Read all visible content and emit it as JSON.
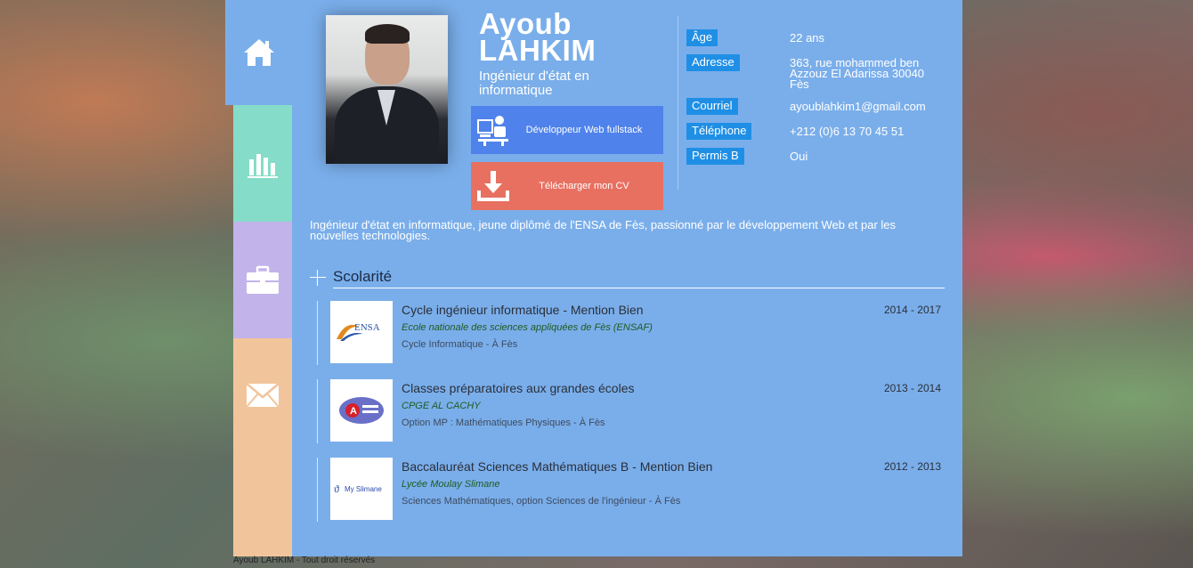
{
  "profile": {
    "first_name": "Ayoub",
    "last_name": "LAHKIM",
    "title": "Ingénieur d'état en informatique",
    "bio": "Ingénieur d'état en informatique, jeune diplômé de l'ENSA de Fès, passionné par le développement Web et par les nouvelles technologies."
  },
  "buttons": {
    "dev": "Développeur Web fullstack",
    "cv": "Télécharger mon CV"
  },
  "info": [
    {
      "label": "Âge",
      "value": "22 ans"
    },
    {
      "label": "Adresse",
      "value": "363, rue mohammed ben Azzouz El Adarissa 30040 Fès"
    },
    {
      "label": "Courriel",
      "value": "ayoublahkim1@gmail.com"
    },
    {
      "label": "Téléphone",
      "value": "+212 (0)6 13 70 45 51"
    },
    {
      "label": "Permis B",
      "value": "Oui"
    }
  ],
  "schooling": {
    "heading": "Scolarité",
    "items": [
      {
        "logo_text": "ENSA",
        "title": "Cycle ingénieur informatique - Mention Bien",
        "school": "Ecole nationale des sciences appliquées de Fès (ENSAF)",
        "detail": "Cycle Informatique - À Fès",
        "years": "2014 - 2017"
      },
      {
        "logo_text": "A",
        "title": "Classes préparatoires aux grandes écoles",
        "school": "CPGE AL CACHY",
        "detail": "Option MP : Mathématiques Physiques - À Fès",
        "years": "2013 - 2014"
      },
      {
        "logo_text": "My Slimane",
        "title": "Baccalauréat Sciences Mathématiques B - Mention Bien",
        "school": "Lycée Moulay Slimane",
        "detail": "Sciences Mathématiques, option Sciences de l'ingénieur - À Fès",
        "years": "2012 - 2013"
      }
    ]
  },
  "footer": "Ayoub LAHKIM - Tout droit réservés",
  "colors": {
    "panel": "#7aaeea",
    "tab_stats": "#85dcc8",
    "tab_work": "#c2b3ea",
    "tab_mail": "#f2c49b",
    "btn_dev": "#4f82ea",
    "btn_cv": "#e87061",
    "label_bg": "#1f8fe6"
  },
  "icons": {
    "nav": [
      "home-icon",
      "bar-chart-icon",
      "briefcase-icon",
      "envelope-icon"
    ],
    "buttons": [
      "developer-icon",
      "download-icon"
    ]
  }
}
